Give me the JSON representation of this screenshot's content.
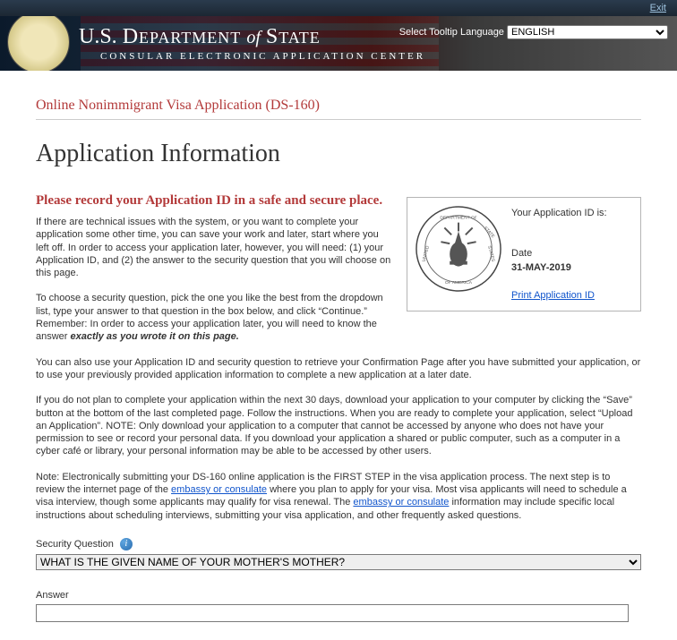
{
  "top": {
    "exit": "Exit"
  },
  "header": {
    "dept_us": "U.S.",
    "dept_d": "D",
    "dept_ept": "EPARTMENT",
    "dept_of": "of",
    "dept_s": "S",
    "dept_tate": "TATE",
    "ceac": "CONSULAR ELECTRONIC APPLICATION CENTER",
    "lang_label": "Select Tooltip Language",
    "lang_value": "ENGLISH"
  },
  "page": {
    "subtitle": "Online Nonimmigrant Visa Application (DS-160)",
    "title": "Application Information",
    "record_line": "Please record your Application ID in a safe and secure place."
  },
  "idbox": {
    "your_id_label": "Your Application ID is:",
    "date_label": "Date",
    "date_value": "31-MAY-2019",
    "print_link": "Print Application ID"
  },
  "paras": {
    "p1a": "If there are technical issues with the system, or you want to complete your application some other time, you can save your work and later, start where you left off. In order to access your application later, however, you will need: (1) your Application ID, and (2) the answer to the security question that you will choose on this page.",
    "p2a": "To choose a security question, pick the one you like the best from the dropdown list, type your answer to that question in the box below, and click “Continue.” Remember: In order to access your application later, you will need to know the answer ",
    "p2em": "exactly as you wrote it on this page.",
    "p3": "You can also use your Application ID and security question to retrieve your Confirmation Page after you have submitted your application, or to use your previously provided application information to complete a new application at a later date.",
    "p4": "If you do not plan to complete your application within the next 30 days, download your application to your computer by clicking the “Save” button at the bottom of the last completed page. Follow the instructions. When you are ready to complete your application, select “Upload an Application”. NOTE: Only download your application to a computer that cannot be accessed by anyone who does not have your permission to see or record your personal data. If you download your application a shared or public computer, such as a computer in a cyber café or library, your personal information may be able to be accessed by other users.",
    "p5a": "Note: Electronically submitting your DS-160 online application is the FIRST STEP in the visa application process. The next step is to review the internet page of the ",
    "p5link1": "embassy or consulate",
    "p5b": " where you plan to apply for your visa. Most visa applicants will need to schedule a visa interview, though some applicants may qualify for visa renewal. The ",
    "p5link2": "embassy or consulate",
    "p5c": " information may include specific local instructions about scheduling interviews, submitting your visa application, and other frequently asked questions."
  },
  "form": {
    "security_question_label": "Security Question",
    "security_question_value": "WHAT IS THE GIVEN NAME OF YOUR MOTHER'S MOTHER?",
    "answer_label": "Answer",
    "answer_value": ""
  }
}
